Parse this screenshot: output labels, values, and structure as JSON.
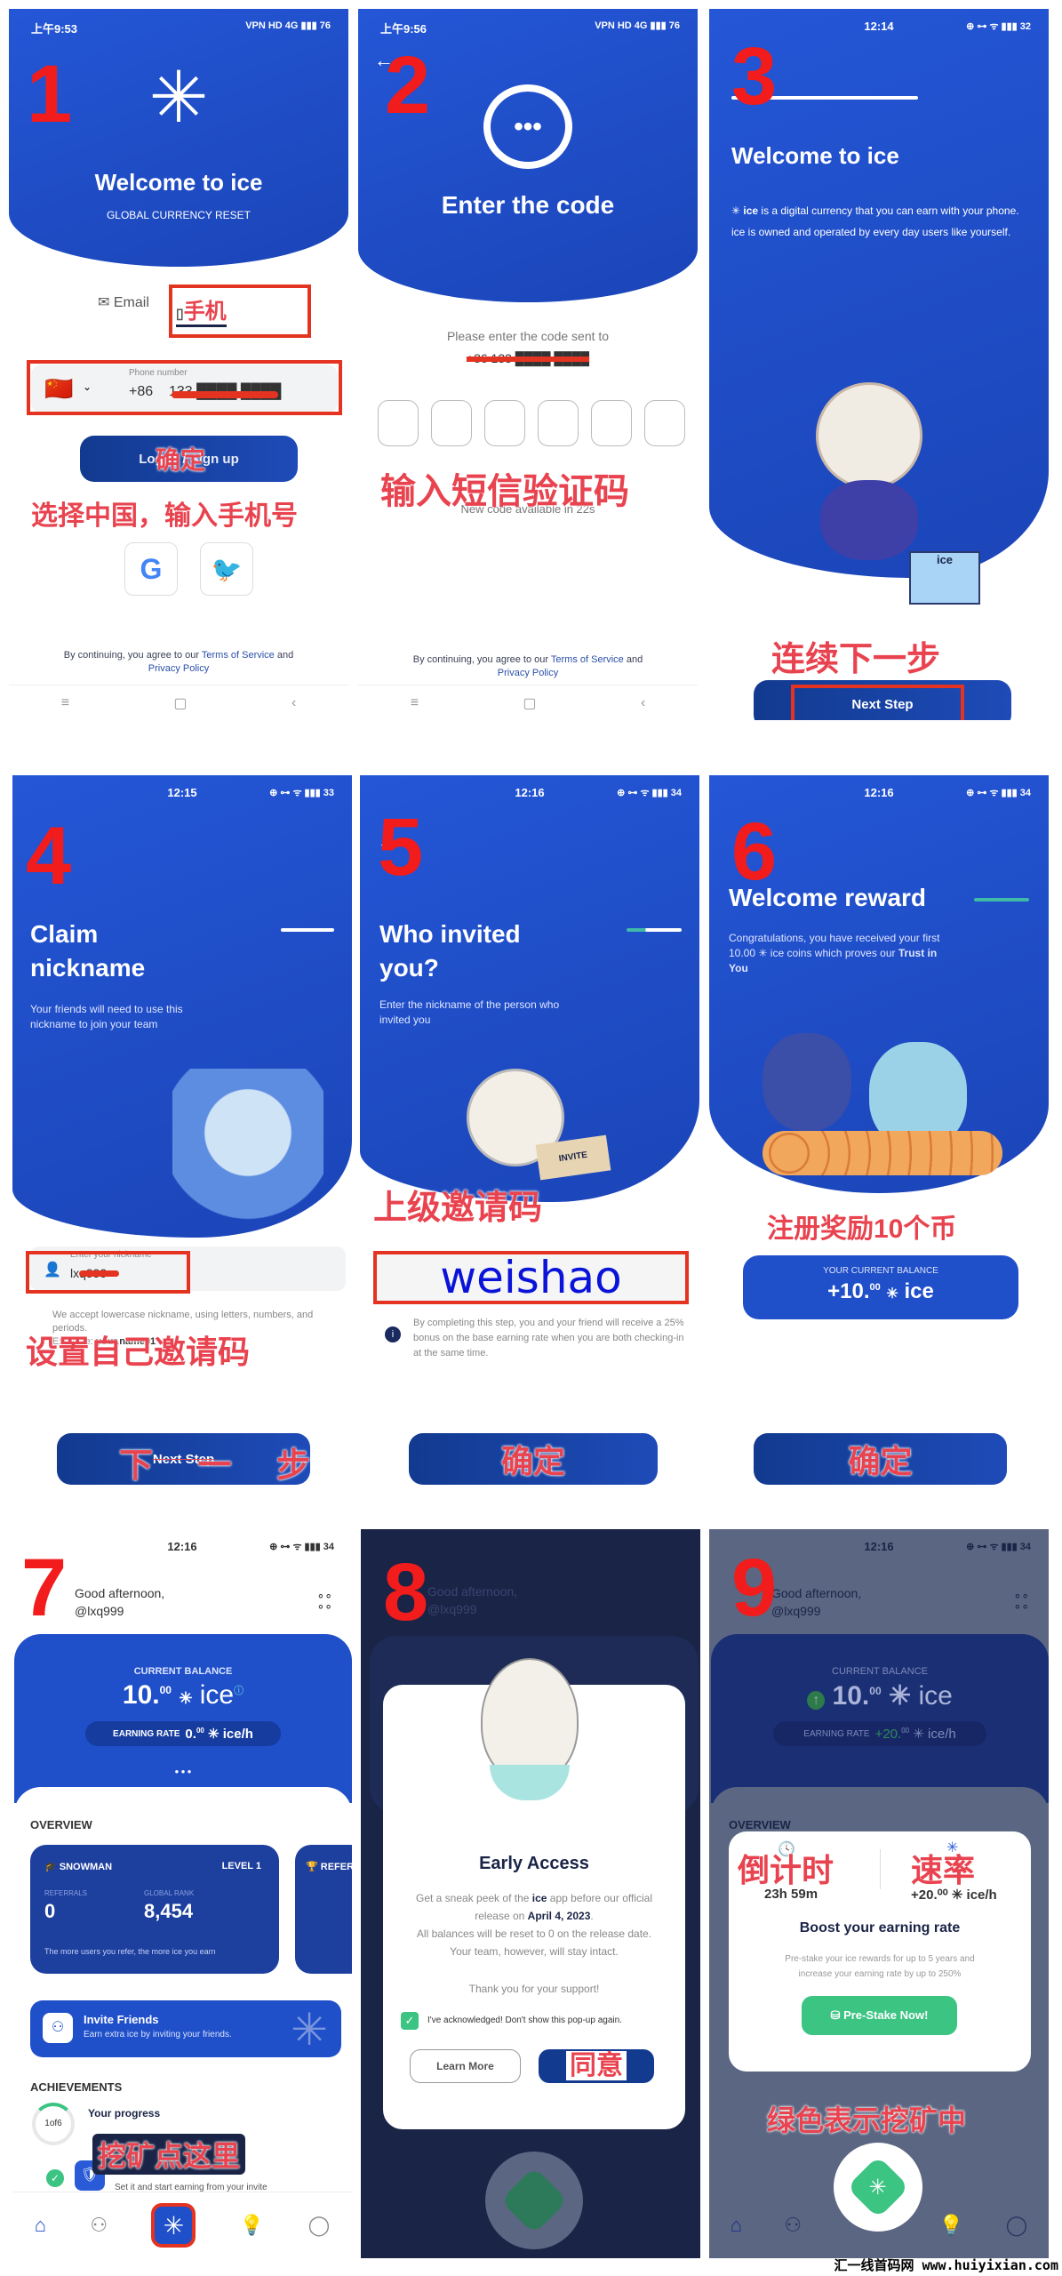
{
  "watermark": "汇一线首码网 www.huiyixian.com",
  "steps": [
    {
      "number": "1",
      "status": {
        "time": "上午9:53",
        "icons": "VPN HD 4G ▮▮▮ 76"
      },
      "title": "Welcome to ice",
      "subtitle": "GLOBAL CURRENCY RESET",
      "tabs": [
        {
          "label": "Email",
          "icon": "mail-icon"
        },
        {
          "label": "手机",
          "icon": "phone-icon",
          "active": true
        }
      ],
      "phone_field": {
        "label": "Phone number",
        "country": "China",
        "flag": "🇨🇳",
        "code": "+86",
        "value": "133 ████ ████"
      },
      "login_button": "Log in / Sign up",
      "login_overlay": "确定",
      "annotation": "选择中国，输入手机号",
      "social": [
        {
          "name": "google",
          "label": "G"
        },
        {
          "name": "twitter",
          "label": "🐦"
        }
      ],
      "tos": {
        "prefix": "By continuing, you agree to our",
        "terms": "Terms of Service",
        "and": "and",
        "privacy": "Privacy Policy"
      },
      "nav": [
        "≡",
        "▢",
        "‹"
      ]
    },
    {
      "number": "2",
      "status": {
        "time": "上午9:56",
        "icons": "VPN HD 4G ▮▮▮ 76"
      },
      "back": "←",
      "title": "Enter the code",
      "prompt": "Please enter the code sent to",
      "phone": "+86 133 ████ ████",
      "code_boxes": [
        "",
        "",
        "",
        "",
        "",
        ""
      ],
      "resend": "New code available in 22s",
      "annotation": "输入短信验证码",
      "tos": {
        "prefix": "By continuing, you agree to our",
        "terms": "Terms of Service",
        "and": "and",
        "privacy": "Privacy Policy"
      },
      "nav": [
        "≡",
        "▢",
        "‹"
      ]
    },
    {
      "number": "3",
      "status": {
        "time": "12:14",
        "icons": "⊕ ⊶ ᯤ ▮▮▮ 32"
      },
      "title": "Welcome to ice",
      "description_bold": "ice",
      "description": "is a digital currency that you can earn with your phone. ice is owned and operated by every day users like yourself.",
      "annotation": "连续下一步",
      "box_label": "ice",
      "button": "Next Step"
    },
    {
      "number": "4",
      "status": {
        "time": "12:15",
        "icons": "⊕ ⊶ ᯤ ▮▮▮ 33"
      },
      "title_line1": "Claim",
      "title_line2": "nickname",
      "description": "Your friends will need to use this nickname to join your team",
      "field_label": "Enter your nickname",
      "field_value": "lxq999",
      "hint": "We accept lowercase nickname, using letters, numbers, and periods.",
      "example_label": "Example:",
      "example_value": "your.name01",
      "annotation": "设置自己邀请码",
      "button": "Next Step",
      "button_overlay": "下 一 步"
    },
    {
      "number": "5",
      "status": {
        "time": "12:16",
        "icons": "⊕ ⊶ ᯤ ▮▮▮ 34"
      },
      "back": "←",
      "title_line1": "Who invited",
      "title_line2": "you?",
      "description": "Enter the nickname of the person who invited you",
      "card_label": "INVITE",
      "annotation": "上级邀请码",
      "field_value": "weishao",
      "info": "By completing this step, you and your friend will receive a 25% bonus on the base earning rate when you are both checking-in at the same time.",
      "button": "确定"
    },
    {
      "number": "6",
      "status": {
        "time": "12:16",
        "icons": "⊕ ⊶ ᯤ ▮▮▮ 34"
      },
      "title": "Welcome reward",
      "description_pre": "Congratulations, you have received your first 10.00",
      "description_mid": "ice coins which proves our",
      "description_bold": "Trust in You",
      "annotation": "注册奖励10个币",
      "balance_label": "YOUR CURRENT BALANCE",
      "balance_int": "+10.",
      "balance_dec": "00",
      "balance_unit": "ice",
      "button": "确定"
    },
    {
      "number": "7",
      "status": {
        "time": "12:16",
        "icons": "⊕ ⊶ ᯤ ▮▮▮ 34"
      },
      "greeting": "Good afternoon,",
      "username": "@lxq999",
      "balance_label": "CURRENT BALANCE",
      "balance_int": "10.",
      "balance_dec": "00",
      "balance_unit": "ice",
      "rate_label": "EARNING RATE",
      "rate_int": "0.",
      "rate_dec": "00",
      "rate_unit": "ice/h",
      "overview": "OVERVIEW",
      "card": {
        "title": "SNOWMAN",
        "level": "LEVEL 1",
        "referrals_label": "REFERRALS",
        "referrals": "0",
        "rank_label": "GLOBAL RANK",
        "rank": "8,454",
        "footer": "The more users you refer, the more ice you earn"
      },
      "card2_title": "REFER",
      "invite": {
        "title": "Invite Friends",
        "subtitle": "Earn extra ice by inviting your friends."
      },
      "achievements": "ACHIEVEMENTS",
      "progress_label": "1of6",
      "progress_fraction": 0.1667,
      "progress_title": "Your progress",
      "task_text": "Set it and start earning from your invite",
      "annotation": "挖矿点这里",
      "tabs": [
        "home",
        "team",
        "mine",
        "ideas",
        "profile"
      ]
    },
    {
      "number": "8",
      "greeting": "Good afternoon,",
      "username": "@lxq999",
      "modal": {
        "title": "Early Access",
        "line1_pre": "Get a sneak peek of the",
        "line1_bold": "ice",
        "line1_post": "app before our official release on",
        "date": "April 4, 2023",
        "line2": "All balances will be reset to 0 on the release date. Your team, however, will stay intact.",
        "thanks": "Thank you for your support!",
        "checkbox": "I've acknowledged! Don't show this pop-up again.",
        "checked": true,
        "learn_more": "Learn More",
        "confirm_overlay": "同意"
      }
    },
    {
      "number": "9",
      "status": {
        "time": "12:16",
        "icons": "⊕ ⊶ ᯤ ▮▮▮ 34"
      },
      "greeting": "Good afternoon,",
      "username": "@lxq999",
      "balance_label": "CURRENT BALANCE",
      "balance_int": "10.",
      "balance_dec": "00",
      "balance_unit": "ice",
      "rate_label": "EARNING RATE",
      "rate_value": "+20.",
      "rate_dec": "00",
      "rate_unit": "ice/h",
      "overview": "OVERVIEW",
      "popup": {
        "countdown_annot": "倒计时",
        "rate_annot": "速率",
        "countdown": "23h 59m",
        "rate": "+20.⁰⁰ ✳ ice/h",
        "title": "Boost your earning rate",
        "desc": "Pre-stake your ice rewards for up to 5 years and increase your earning rate by up to 250%",
        "button": "Pre-Stake Now!"
      },
      "annotation": "绿色表示挖矿中"
    }
  ],
  "colors": {
    "brand_blue": "#1f4fc9",
    "dark_blue": "#123a8f",
    "annotation_red": "#e8434f",
    "green": "#35c47a"
  }
}
